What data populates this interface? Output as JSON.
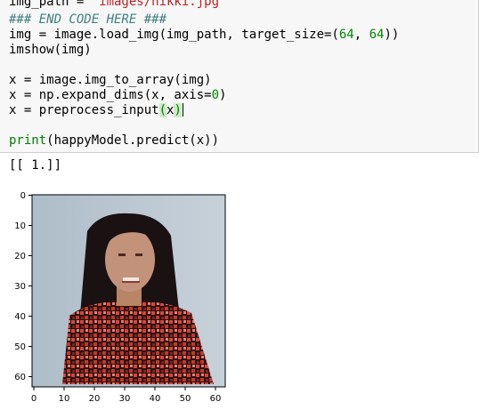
{
  "code": {
    "line1_pre": "img_path = ",
    "line1_str": "'images/nikki.jpg'",
    "line2": "### END CODE HERE ###",
    "line3_pre": "img = image.load_img(img_path, target_size=(",
    "line3_n1": "64",
    "line3_mid": ", ",
    "line3_n2": "64",
    "line3_post": "))",
    "line4": "imshow(img)",
    "line6": "x = image.img_to_array(img)",
    "line7_pre": "x = np.expand_dims(x, axis=",
    "line7_num": "0",
    "line7_post": ")",
    "line8_pre": "x = preprocess_input",
    "line8_open": "(",
    "line8_arg": "x",
    "line8_close": ")",
    "line10_kw": "print",
    "line10_rest": "(happyModel.predict(x))"
  },
  "output": {
    "text": "[[ 1.]]"
  },
  "plot": {
    "image_subject": "pixelated photo of a smiling woman with long dark hair wearing a red and black floral top",
    "y_ticks": [
      "0",
      "10",
      "20",
      "30",
      "40",
      "50",
      "60"
    ],
    "x_ticks": [
      "0",
      "10",
      "20",
      "30",
      "40",
      "50",
      "60"
    ]
  }
}
